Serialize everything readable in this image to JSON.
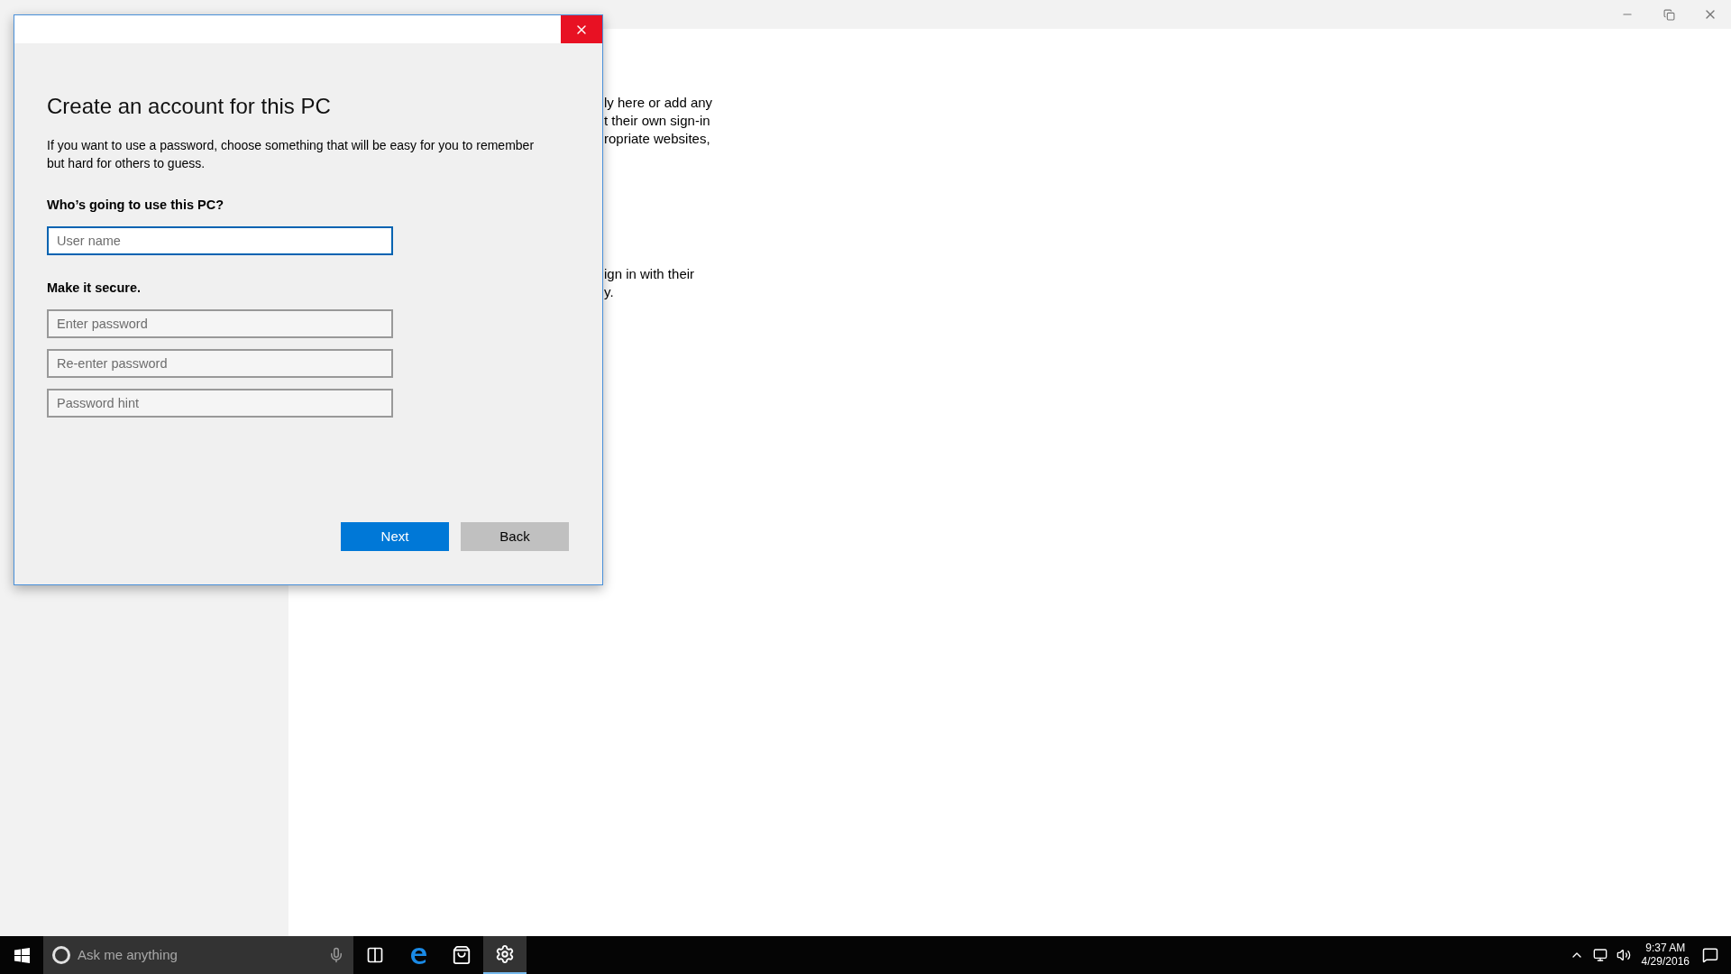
{
  "background_text": {
    "paragraphs": [
      [
        "ly here or add any",
        "t their own sign-in",
        "ropriate websites,"
      ],
      [
        "ign in with their",
        "y."
      ]
    ]
  },
  "dialog": {
    "title": "Create an account for this PC",
    "description": "If you want to use a password, choose something that will be easy for you to remember but hard for others to guess.",
    "sections": [
      {
        "label": "Who’s going to use this PC?",
        "fields": [
          {
            "placeholder": "User name",
            "focused": true
          }
        ]
      },
      {
        "label": "Make it secure.",
        "fields": [
          {
            "placeholder": "Enter password",
            "focused": false
          },
          {
            "placeholder": "Re-enter password",
            "focused": false
          },
          {
            "placeholder": "Password hint",
            "focused": false
          }
        ]
      }
    ],
    "buttons": [
      {
        "label": "Next",
        "kind": "primary"
      },
      {
        "label": "Back",
        "kind": "secondary"
      }
    ]
  },
  "taskbar": {
    "search": {
      "placeholder": "Ask me anything"
    },
    "apps": [
      {
        "kind": "task-view",
        "active": false
      },
      {
        "kind": "browser",
        "active": false
      },
      {
        "kind": "store",
        "active": false
      },
      {
        "kind": "settings",
        "active": true
      }
    ],
    "clock": {
      "time": "9:37 AM",
      "date": "4/29/2016"
    }
  }
}
